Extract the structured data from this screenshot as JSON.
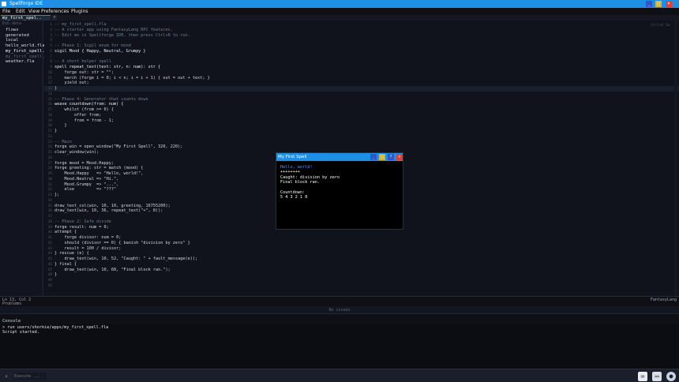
{
  "titlebar": {
    "title": "Spellforge IDE",
    "min": "_",
    "max": "▢",
    "close": "×"
  },
  "menu": [
    "File",
    "Edit",
    "View",
    "Preferences",
    "Plugins"
  ],
  "tab": {
    "label": "my_first_spel..",
    "close": "×"
  },
  "sidebar": {
    "header": "Esh.data",
    "items": [
      {
        "label": "flows",
        "state": "normal"
      },
      {
        "label": "generated",
        "state": "normal"
      },
      {
        "label": "local",
        "state": "normal"
      },
      {
        "label": "hello_world.fla",
        "state": "normal"
      },
      {
        "label": "my_first_spell.",
        "state": "active"
      },
      {
        "label": "my_first_spell.",
        "state": "dim"
      },
      {
        "label": "weather.fla",
        "state": "normal"
      }
    ]
  },
  "editor": {
    "hint": "Ctrl+S   Sa",
    "current_line": 13,
    "lines": [
      {
        "t": "-- my_first_spell.fla",
        "c": "comment"
      },
      {
        "t": "-- A starter app using FantasyLang RPC features.",
        "c": "comment"
      },
      {
        "t": "-- Edit me in Spellforge IDE, then press Ctrl+R to run.",
        "c": "comment"
      },
      {
        "t": "",
        "c": ""
      },
      {
        "t": "-- Phase 1: Sigil enum for mood",
        "c": "comment"
      },
      {
        "t": "sigil Mood { Happy, Neutral, Grumpy }",
        "c": "kw"
      },
      {
        "t": "",
        "c": ""
      },
      {
        "t": "-- A short helper spell",
        "c": "comment"
      },
      {
        "t": "spell repeat_text(text: str, n: num): str {",
        "c": "kw"
      },
      {
        "t": "    forge out: str = \"\";",
        "c": ""
      },
      {
        "t": "    march (forge i = 0; i < n; i = i + 1) { out = out + text; }",
        "c": ""
      },
      {
        "t": "    yield out;",
        "c": ""
      },
      {
        "t": "}",
        "c": ""
      },
      {
        "t": "",
        "c": ""
      },
      {
        "t": "-- Phase 4: Generator that counts down",
        "c": "comment"
      },
      {
        "t": "weave countdown(from: num) {",
        "c": "kw"
      },
      {
        "t": "    whilst (from >= 0) {",
        "c": ""
      },
      {
        "t": "        offer from;",
        "c": ""
      },
      {
        "t": "        from = from - 1;",
        "c": ""
      },
      {
        "t": "    }",
        "c": ""
      },
      {
        "t": "}",
        "c": ""
      },
      {
        "t": "",
        "c": ""
      },
      {
        "t": "-- Main",
        "c": "comment"
      },
      {
        "t": "forge win = open_window(\"My First Spell\", 320, 220);",
        "c": ""
      },
      {
        "t": "clear_window(win);",
        "c": ""
      },
      {
        "t": "",
        "c": ""
      },
      {
        "t": "forge mood = Mood.Happy;",
        "c": ""
      },
      {
        "t": "forge greeting: str = match (mood) {",
        "c": ""
      },
      {
        "t": "    Mood.Happy   => \"Hello, world!\",",
        "c": ""
      },
      {
        "t": "    Mood.Neutral => \"Hi.\",",
        "c": ""
      },
      {
        "t": "    Mood.Grumpy  => \"...\",",
        "c": ""
      },
      {
        "t": "    else         => \"???\"",
        "c": ""
      },
      {
        "t": "};",
        "c": ""
      },
      {
        "t": "",
        "c": ""
      },
      {
        "t": "draw_text_col(win, 10, 10, greeting, 16755200);",
        "c": ""
      },
      {
        "t": "draw_text(win, 10, 36, repeat_text(\"+\", 8));",
        "c": ""
      },
      {
        "t": "",
        "c": ""
      },
      {
        "t": "-- Phase 2: Safe divide",
        "c": "comment"
      },
      {
        "t": "forge result: num = 0;",
        "c": ""
      },
      {
        "t": "attempt {",
        "c": ""
      },
      {
        "t": "    forge divisor: num = 0;",
        "c": ""
      },
      {
        "t": "    should (divisor == 0) { banish \"division by zero\" }",
        "c": ""
      },
      {
        "t": "    result = 100 / divisor;",
        "c": ""
      },
      {
        "t": "} rescue (e) {",
        "c": ""
      },
      {
        "t": "    draw_text(win, 10, 52, \"Caught: \" + fault_message(e));",
        "c": ""
      },
      {
        "t": "} final {",
        "c": ""
      },
      {
        "t": "    draw_text(win, 10, 68, \"Final block ran.\");",
        "c": ""
      },
      {
        "t": "}",
        "c": ""
      },
      {
        "t": "",
        "c": ""
      },
      {
        "t": "",
        "c": ""
      }
    ]
  },
  "status": {
    "position": "Ln 13, Col 2",
    "language": "FantasyLang"
  },
  "problems": {
    "header": "Problems",
    "empty": "No issues"
  },
  "console": {
    "header": "Console",
    "lines": [
      "> run users/shorkie/apps/my_first_spell.fla",
      "Script started."
    ]
  },
  "command": {
    "icon": "⚡",
    "placeholder": "Execute ..."
  },
  "runwindow": {
    "title": "My First Spell",
    "buttons": [
      "_",
      "▢",
      "?",
      "×"
    ],
    "lines": [
      {
        "t": "Hello, world!",
        "color": "#4d9bff"
      },
      {
        "t": "++++++++",
        "color": "#ffffff"
      },
      {
        "t": "Caught: division by zero",
        "color": "#ffffff"
      },
      {
        "t": "Final block ran.",
        "color": "#ffffff"
      },
      {
        "t": "",
        "color": "#ffffff"
      },
      {
        "t": "Countdown:",
        "color": "#ffffff"
      },
      {
        "t": "5 4 3 2 1 0",
        "color": "#ffffff"
      }
    ]
  },
  "colors": {
    "accent": "#1e8fe3",
    "background": "#10131b",
    "greeting": "#4d9bff"
  },
  "tray": [
    "chat-icon",
    "window-icon",
    "user-icon"
  ]
}
